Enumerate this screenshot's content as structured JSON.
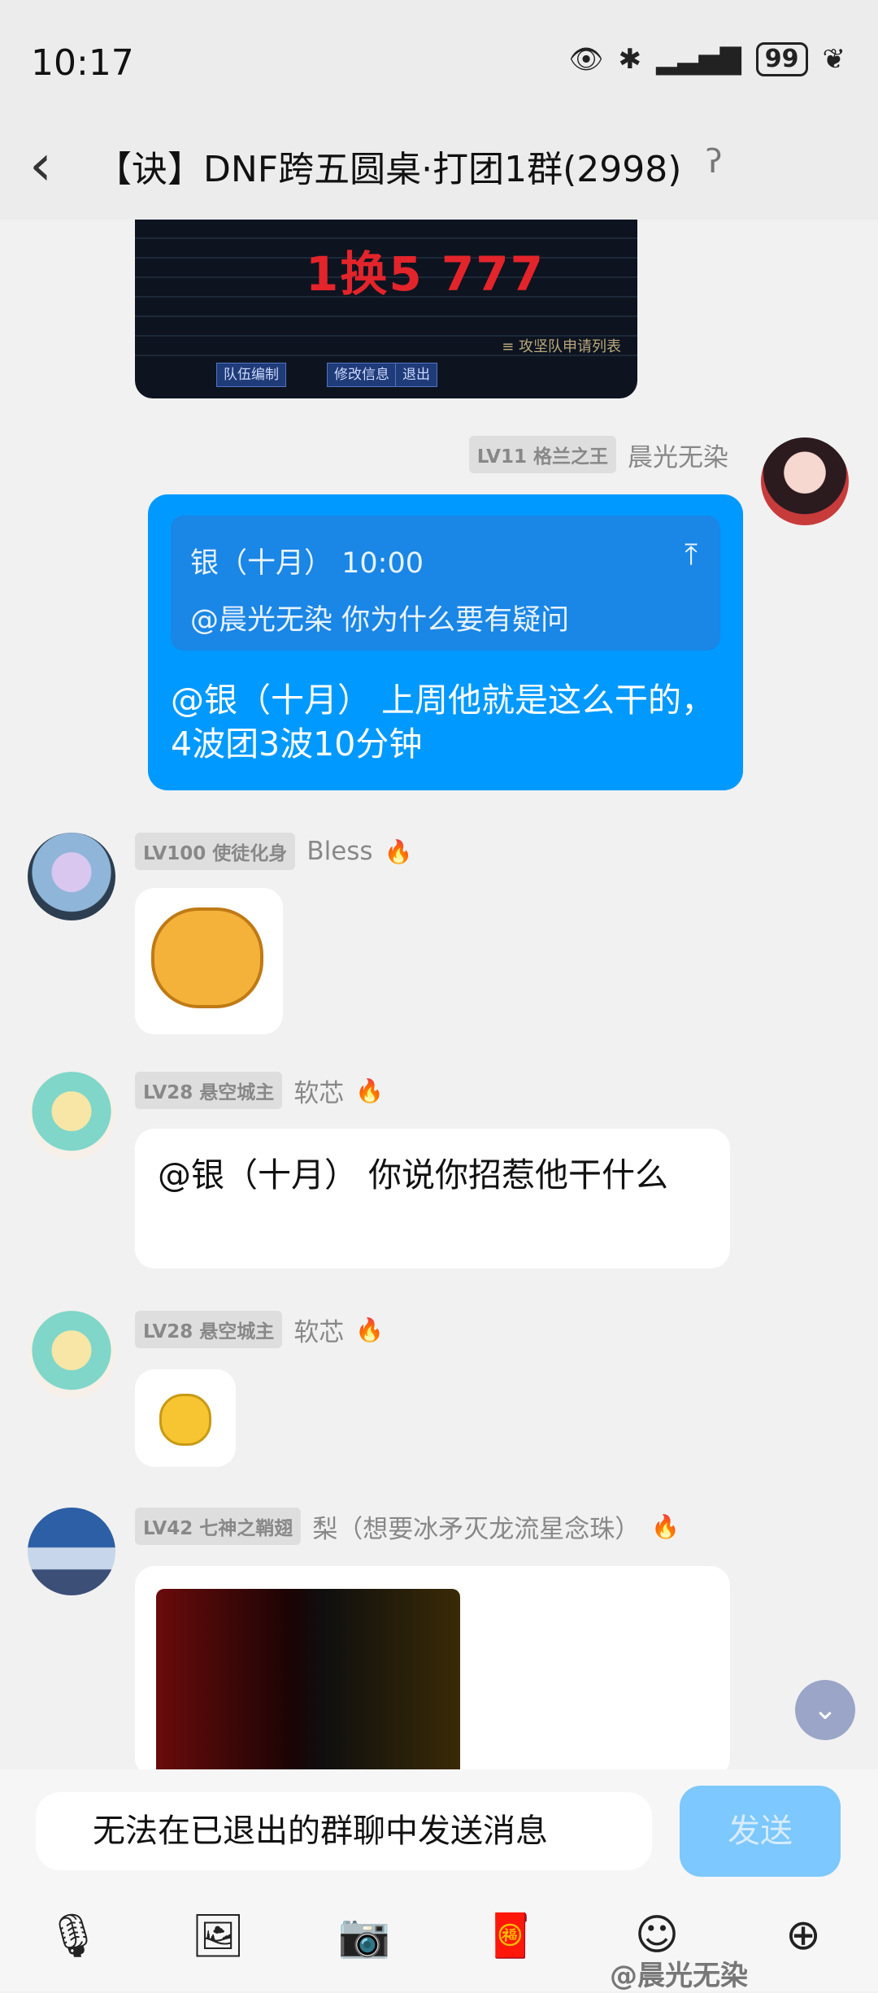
{
  "status": {
    "time": "10:17",
    "battery": "99"
  },
  "header": {
    "title": "【诀】DNF跨五圆桌·打团1群(2998)"
  },
  "top_image": {
    "big_text": "1换5   777",
    "note": "≡ 攻坚队申请列表",
    "btn1": "队伍编制",
    "btn2": "修改信息",
    "btn3": "退出"
  },
  "messages": {
    "m1": {
      "level": "LV11 格兰之王",
      "name": "晨光无染",
      "quote_head": "银（十月） 10:00",
      "quote_body": "@晨光无染 你为什么要有疑问",
      "text": "@银（十月） 上周他就是这么干的，4波团3波10分钟"
    },
    "m2": {
      "level": "LV100 使徒化身",
      "name": "Bless"
    },
    "m3": {
      "level": "LV28 悬空城主",
      "name": "软芯",
      "text": "@银（十月） 你说你招惹他干什么"
    },
    "m4": {
      "level": "LV28 悬空城主",
      "name": "软芯"
    },
    "m5": {
      "level": "LV42 七神之鞘翅",
      "name": "梨（想要冰矛灭龙流星念珠）"
    }
  },
  "input": {
    "placeholder": "无法在已退出的群聊中发送消息",
    "send": "发送"
  },
  "watermark": "@晨光无染"
}
